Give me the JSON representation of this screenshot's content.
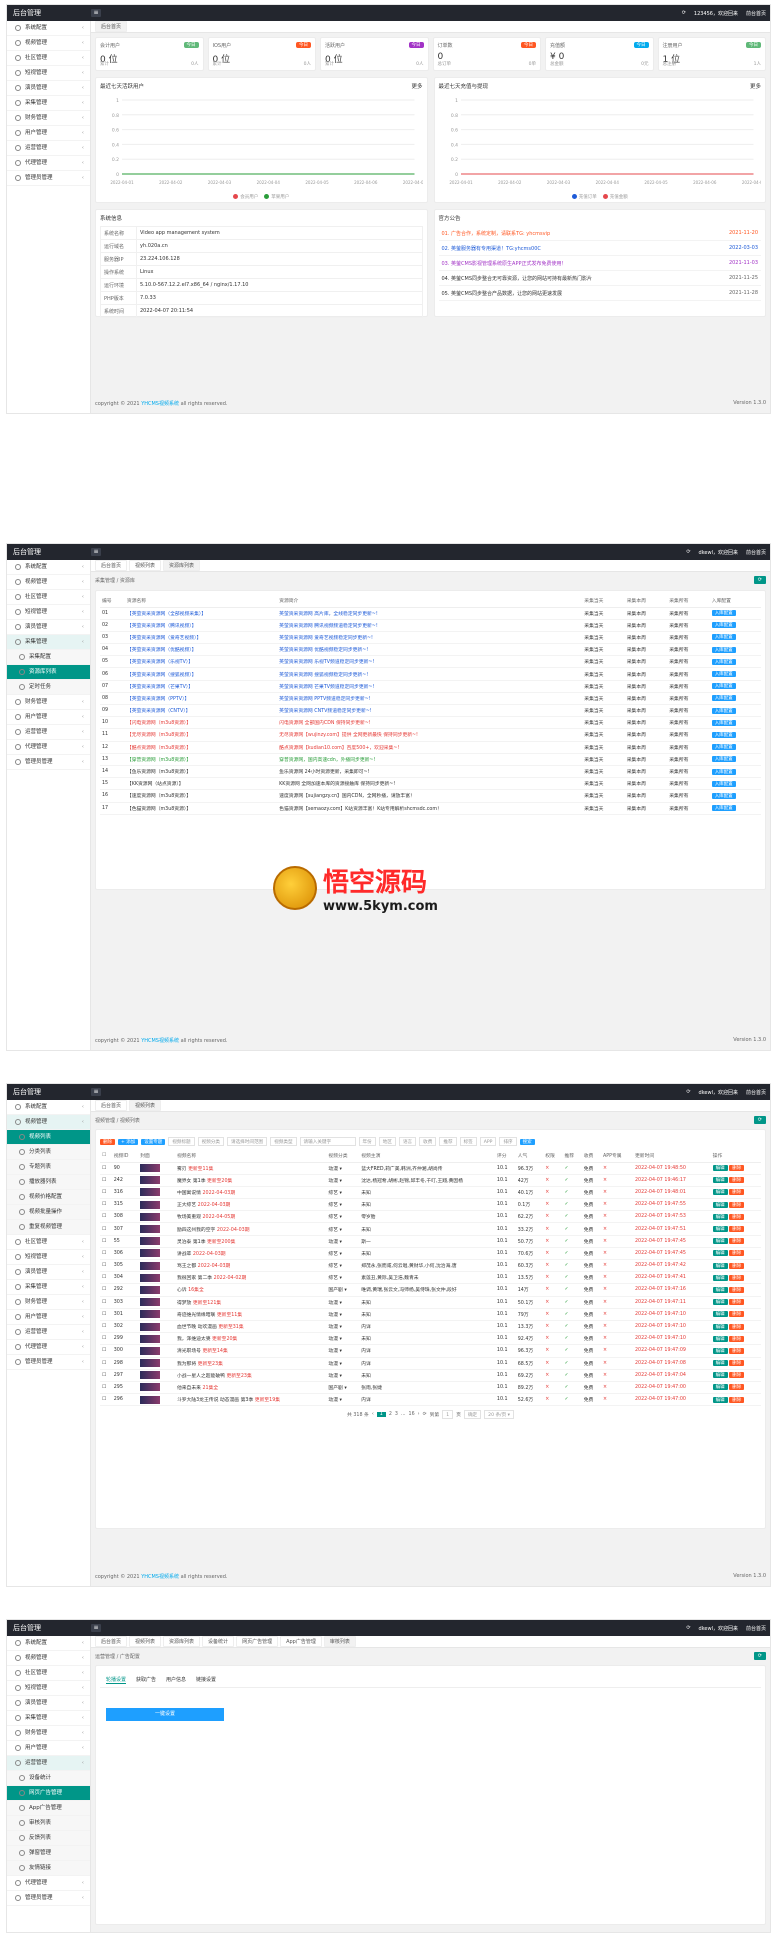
{
  "app_title": "后台管理",
  "s1": {
    "user": "123456，欢迎回来",
    "back": "前台首页",
    "tab": "后台首页",
    "menu": [
      "系统配置",
      "视频管理",
      "社区管理",
      "短视管理",
      "演员管理",
      "采集管理",
      "财务管理",
      "用户管理",
      "运营管理",
      "代理管理",
      "管理员管理"
    ],
    "stats": [
      {
        "title": "会计用户",
        "tag": "今日",
        "tag_color": "#5FB878",
        "value": "0 位",
        "f_l": "累计",
        "f_r": "0人"
      },
      {
        "title": "IOS用户",
        "tag": "今日",
        "tag_color": "#FF5722",
        "value": "0 位",
        "f_l": "累计",
        "f_r": "0人"
      },
      {
        "title": "活跃用户",
        "tag": "今日",
        "tag_color": "#a233c6",
        "value": "0 位",
        "f_l": "累计",
        "f_r": "0人"
      },
      {
        "title": "订单数",
        "tag": "今日",
        "tag_color": "#FF5722",
        "value": "0",
        "f_l": "总订单",
        "f_r": "0单"
      },
      {
        "title": "充值额",
        "tag": "今日",
        "tag_color": "#01AAED",
        "value": "¥ 0",
        "f_l": "总金额",
        "f_r": "0元"
      },
      {
        "title": "注册用户",
        "tag": "今日",
        "tag_color": "#5FB878",
        "value": "1 位",
        "f_l": "总注册",
        "f_r": "1人"
      }
    ],
    "chart_left_title": "最近七天活跃用户",
    "chart_right_title": "最近七天充值与提现",
    "more": "更多",
    "chart_left": {
      "type": "line",
      "categories": [
        "2022-04-01",
        "2022-04-02",
        "2022-04-03",
        "2022-04-04",
        "2022-04-05",
        "2022-04-06",
        "2022-04-07"
      ],
      "series": [
        {
          "name": "会员用户",
          "values": [
            0,
            0,
            0,
            0,
            0,
            0,
            0
          ],
          "color": "#e5484d"
        },
        {
          "name": "苹果用户",
          "values": [
            0,
            0,
            0,
            0,
            0,
            0,
            0
          ],
          "color": "#2a9d3a"
        }
      ],
      "ylim": [
        0,
        1
      ],
      "yticks": [
        "1",
        "0.8",
        "0.6",
        "0.4",
        "0.2",
        "0"
      ]
    },
    "chart_right": {
      "type": "line",
      "categories": [
        "2022-04-01",
        "2022-04-02",
        "2022-04-03",
        "2022-04-04",
        "2022-04-05",
        "2022-04-06",
        "2022-04-07"
      ],
      "series": [
        {
          "name": "充值订单",
          "values": [
            0,
            0,
            0,
            0,
            0,
            0,
            0
          ],
          "color": "#1e5bd8"
        },
        {
          "name": "充值金额",
          "values": [
            0,
            0,
            0,
            0,
            0,
            0,
            0
          ],
          "color": "#e5484d"
        }
      ],
      "ylim": [
        0,
        1
      ],
      "yticks": [
        "1",
        "0.8",
        "0.6",
        "0.4",
        "0.2",
        "0"
      ]
    },
    "sys_title": "系统信息",
    "sys_rows": [
      [
        "系统名称",
        "Video app management system"
      ],
      [
        "运行域名",
        "yh.020a.cn"
      ],
      [
        "服务器IP",
        "23.224.106.128"
      ],
      [
        "操作系统",
        "Linux"
      ],
      [
        "运行环境",
        "5.10.0-567.12.2.el7.x86_64 / nginx/1.17.10"
      ],
      [
        "PHP版本",
        "7.0.33"
      ],
      [
        "系统时间",
        "2022-04-07 20:11:54"
      ]
    ],
    "notice_title": "官方公告",
    "notices": [
      {
        "text": "01. 广告合作，系统定制，请联系TG: yhcmsvip",
        "date": "2021-11-20",
        "color": "#FF5722"
      },
      {
        "text": "02. 英萤服务器有专用渠道！TG:yhcms00C",
        "date": "2022-03-03",
        "color": "#1e5bd8"
      },
      {
        "text": "03. 英萤CMS影视管理系统原生APP正式发布免费使用！",
        "date": "2021-11-03",
        "color": "#a233c6"
      },
      {
        "text": "04. 英萤CMS同步整合无可靠资源，让您的网站可持有最新热门影片",
        "date": "2021-11-25",
        "color": "#333333"
      },
      {
        "text": "05. 英萤CMS同步整合产品数据，让您的网站更速发展",
        "date": "2021-11-28",
        "color": "#333333"
      }
    ],
    "copyright": "copyright © 2021",
    "copyright_link": "YHCMS视频系统",
    "copyright_tail": " all rights reserved.",
    "version": "Version 1.3.0"
  },
  "s2": {
    "user": "dkewl，欢迎回来",
    "back": "前台首页",
    "tabs": [
      "后台首页",
      "视频列表",
      "资源库列表"
    ],
    "crumb": "采集管理 / 资源库",
    "menu_top": [
      "系统配置",
      "视频管理",
      "社区管理",
      "短视管理",
      "演员管理",
      "采集管理"
    ],
    "menu_sub": [
      "采集配置",
      "资源库列表",
      "定时任务"
    ],
    "menu_bottom": [
      "财务管理",
      "用户管理",
      "运营管理",
      "代理管理",
      "管理员管理"
    ],
    "headers": [
      "编号",
      "资源名称",
      "资源简介",
      "采集当天",
      "采集本周",
      "采集所有",
      "入库配置"
    ],
    "rows": [
      [
        "01",
        "【英萤资采资源网（全部视频采集）】",
        "英萤资采资源网 高片库，全线稳定同步更新~!",
        "blue"
      ],
      [
        "02",
        "【英萤资采资源网（腾讯视频）】",
        "英萤资采资源网 腾讯视频频道稳定同步更新~!",
        "blue"
      ],
      [
        "03",
        "【英萤资采资源网（爱奇艺视频）】",
        "英萤资采资源网 爱奇艺视频稳定同步更新~!",
        "blue"
      ],
      [
        "04",
        "【英萤资采资源网（优酷视频）】",
        "英萤资采资源网 优酷视频稳定同步更新~!",
        "blue"
      ],
      [
        "05",
        "【英萤资采资源网（乐视TV）】",
        "英萤资采资源网 乐视TV频道稳定同步更新~!",
        "blue"
      ],
      [
        "06",
        "【英萤资采资源网（搜狐视频）】",
        "英萤资采资源网 搜狐视频稳定同步更新~!",
        "blue"
      ],
      [
        "07",
        "【英萤资采资源网（芒果TV）】",
        "英萤资采资源网 芒果TV频道稳定同步更新~!",
        "blue"
      ],
      [
        "08",
        "【英萤资采资源网（PPTV）】",
        "英萤资采资源网 PPTV频道稳定同步更新~!",
        "blue"
      ],
      [
        "09",
        "【英萤资采资源网（CNTV）】",
        "英萤资采资源网 CNTV频道稳定同步更新~!",
        "blue"
      ],
      [
        "10",
        "【闪电资源网（m3u8资源）】",
        "闪电资源网 全部国内CDN 保持同步更新~!",
        "red"
      ],
      [
        "11",
        "【无尽资源网（m3u8资源）】",
        "无尽资源网【wujinzy.com】提供 全网更新最快 保持同步更新~!",
        "red"
      ],
      [
        "12",
        "【酷点资源网（m3u8资源）】",
        "酷点资源网【kudian10.com】百度500+，欢迎采集~!",
        "red"
      ],
      [
        "13",
        "【穿普资源网（m3u8资源）】",
        "穿普资源网，国内高速cdn，外播同步更新~!",
        "green"
      ],
      [
        "14",
        "【鱼乐资源网（m3u8资源）】",
        "鱼乐资源网 24小时资源更新，采集即可~!",
        "plain"
      ],
      [
        "15",
        "【KK资源网（站点资源）】",
        "KK资源网 全网加速本库的资源接触库 保持同步更新~!",
        "plain"
      ],
      [
        "16",
        "【速度资源网（m3u8资源）】",
        "速度资源网【sujiangzy.cn】国内CDN，全网秒播，请放丰富！",
        "plain"
      ],
      [
        "17",
        "【色猫资源网（m3u8资源）】",
        "色猫资源网【semaozy.com】K站资源丰富！K站专用解析shcmsdc.com！",
        "plain"
      ]
    ],
    "cell_today": "采集当天",
    "cell_week": "采集本周",
    "cell_all": "采集所有",
    "cell_btn": "入库配置",
    "wm_cn": "悟空源码",
    "wm_url": "www.5kym.com",
    "copyright": "copyright © 2021",
    "copyright_link": "YHCMS视频系统",
    "copyright_tail": " all rights reserved.",
    "version": "Version 1.3.0"
  },
  "s3": {
    "user": "dkewl，欢迎回来",
    "back": "前台首页",
    "tabs": [
      "后台首页",
      "视频列表"
    ],
    "crumb": "视频管理 / 视频列表",
    "menu_top": [
      "系统配置",
      "视频管理"
    ],
    "menu_sub": [
      "视频列表",
      "分类列表",
      "专题列表",
      "播放器列表",
      "视频价格配置",
      "视频批量操作",
      "重复视频管理"
    ],
    "menu_bottom": [
      "社区管理",
      "短视管理",
      "演员管理",
      "采集管理",
      "财务管理",
      "用户管理",
      "运营管理",
      "代理管理",
      "管理员管理"
    ],
    "tb_del": "删除",
    "tb_add": "+ 添加",
    "tb_batch": "设置专题",
    "tb_ph": [
      "视频标题",
      "视频分类",
      "请选择时间范围",
      "视频类型",
      "请输入关键字",
      "年份",
      "地区",
      "语言",
      "收费",
      "推荐",
      "标签",
      "APP",
      "排序"
    ],
    "tb_search": "搜索",
    "headers": [
      "视频ID",
      "封面",
      "视频名称",
      "视频分类",
      "视频主演",
      "评分",
      "人气",
      "权限",
      "推荐",
      "收费",
      "APP专属",
      "更新时间",
      "操作"
    ],
    "rows": [
      [
        "90",
        "雾刃",
        "更新至11集",
        "动漫",
        "蓝大FRED,莉广美,韩洲,齐仲湘,胡尚传",
        "10.1",
        "96.3万",
        "2022-04-07 19:48:50"
      ],
      [
        "242",
        "魔界女 第1季",
        "更新至20集",
        "动漫",
        "沈达,杨冠希,胡彬,赵锦,邱丰冬,千叮,王翔,黄因杨",
        "10.1",
        "42万",
        "2022-04-07 19:46:17"
      ],
      [
        "316",
        "中国寓说情",
        "2022-04-03期",
        "综艺",
        "未知",
        "10.1",
        "40.1万",
        "2022-04-07 19:48:01"
      ],
      [
        "315",
        "正大综艺",
        "2022-04-03期",
        "综艺",
        "未知",
        "10.1",
        "0.1万",
        "2022-04-07 19:47:55"
      ],
      [
        "308",
        "牧场美重观",
        "2022-04-05期",
        "综艺",
        "零岁胎",
        "10.1",
        "62.2万",
        "2022-04-07 19:47:53"
      ],
      [
        "307",
        "励四这州我的空字",
        "2022-04-03期",
        "综艺",
        "未知",
        "10.1",
        "33.2万",
        "2022-04-07 19:47:51"
      ],
      [
        "55",
        "灵泊泰 第1季",
        "更新至200集",
        "动漫",
        "斯一",
        "10.1",
        "50.7万",
        "2022-04-07 19:47:45"
      ],
      [
        "306",
        "讲战辈",
        "2022-04-03期",
        "综艺",
        "未知",
        "10.1",
        "70.6万",
        "2022-04-07 19:47:45"
      ],
      [
        "305",
        "骂王之都",
        "2022-04-03期",
        "综艺",
        "郑茂永,张而咸,何云唱,黄财华,小何,沈治海,唐",
        "10.1",
        "60.3万",
        "2022-04-07 19:47:42"
      ],
      [
        "304",
        "我很回家 第二季",
        "2022-04-02期",
        "综艺",
        "素莲丑,黄际,吴卫浩,魏青未",
        "10.1",
        "13.5万",
        "2022-04-07 19:47:41"
      ],
      [
        "292",
        "心诉",
        "16集全",
        "国产剧",
        "唯调,黄瑞,张云文,冯师杨,吴侍珠,张文仲,段好",
        "10.1",
        "14万",
        "2022-04-07 19:47:16"
      ],
      [
        "303",
        "得梦放",
        "更新至121集",
        "动漫",
        "未知",
        "10.1",
        "50.1万",
        "2022-04-07 19:47:11"
      ],
      [
        "301",
        "奇迹维光情缘暗联",
        "更新至11集",
        "动漫",
        "未知",
        "10.1",
        "79万",
        "2022-04-07 19:47:10"
      ],
      [
        "302",
        "血世节晚 动欢漫画",
        "更新至31集",
        "动漫",
        "内详",
        "10.1",
        "13.3万",
        "2022-04-07 19:47:10"
      ],
      [
        "299",
        "我，泽维迪太婆",
        "更新至20集",
        "动漫",
        "未知",
        "10.1",
        "92.4万",
        "2022-04-07 19:47:10"
      ],
      [
        "300",
        "清光职场号",
        "更新至14集",
        "动漫",
        "内详",
        "10.1",
        "96.3万",
        "2022-04-07 19:47:09"
      ],
      [
        "298",
        "我为那将",
        "更新至23集",
        "动漫",
        "内详",
        "10.1",
        "68.5万",
        "2022-04-07 19:47:08"
      ],
      [
        "297",
        "小战一星人之超能破鸭",
        "更新至23集",
        "动漫",
        "未知",
        "10.1",
        "69.2万",
        "2022-04-07 19:47:04"
      ],
      [
        "295",
        "他来自未来",
        "21集全",
        "国产剧",
        "张雨,张婕",
        "10.1",
        "89.2万",
        "2022-04-07 19:47:00"
      ],
      [
        "296",
        "斗罗大陆3龙王传说 动态漫画 第3季",
        "更新至19集",
        "动漫",
        "内详",
        "10.1",
        "52.6万",
        "2022-04-07 19:47:00"
      ]
    ],
    "cross": "×",
    "check": "✓",
    "free": "免费",
    "edit": "编辑",
    "del": "删除",
    "pager_total": "共 318 条",
    "pager_pages": [
      "1",
      "2",
      "3",
      "...",
      "16"
    ],
    "pager_goto": "到第",
    "pager_page": "1",
    "pager_unit": "页",
    "pager_ok": "确定",
    "pager_size": "20 条/页",
    "copyright": "copyright © 2021",
    "copyright_link": "YHCMS视频系统",
    "copyright_tail": " all rights reserved.",
    "version": "Version 1.3.0"
  },
  "s4": {
    "user": "dkewl，欢迎回来",
    "back": "前台首页",
    "tabs": [
      "后台首页",
      "视频列表",
      "资源库列表",
      "设备统计",
      "网页广告管理",
      "App广告管理",
      "审核列表"
    ],
    "crumb": "运营管理 / 广告配置",
    "menu_top": [
      "系统配置",
      "视频管理",
      "社区管理",
      "短视管理",
      "演员管理",
      "采集管理",
      "财务管理",
      "用户管理",
      "运营管理"
    ],
    "menu_sub": [
      "设备统计",
      "网页广告管理",
      "App广告管理",
      "审核列表",
      "反馈列表",
      "弹窗管理",
      "友情链接"
    ],
    "menu_bottom": [
      "代理管理",
      "管理员管理"
    ],
    "subtabs": [
      "轮播设置",
      "获取广告",
      "用户信息",
      "链接设置"
    ],
    "add": "一键设置"
  }
}
